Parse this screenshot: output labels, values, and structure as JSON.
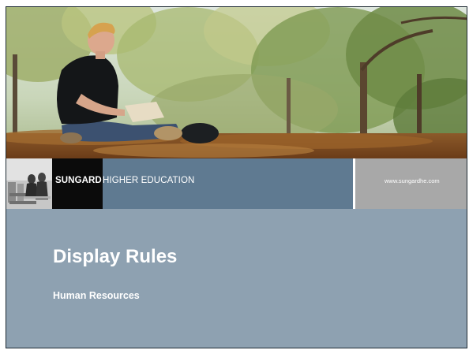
{
  "slide": {
    "title": "Display Rules",
    "subtitle": "Human Resources"
  },
  "banner": {
    "brand": "SUNGARD",
    "division": "HIGHER EDUCATION",
    "url": "www.sungardhe.com"
  },
  "colors": {
    "slide_background": "#8ea1b1",
    "banner_blue": "#5f7a91",
    "brand_block": "#0b0b0b",
    "url_block": "#a8a8a8"
  }
}
